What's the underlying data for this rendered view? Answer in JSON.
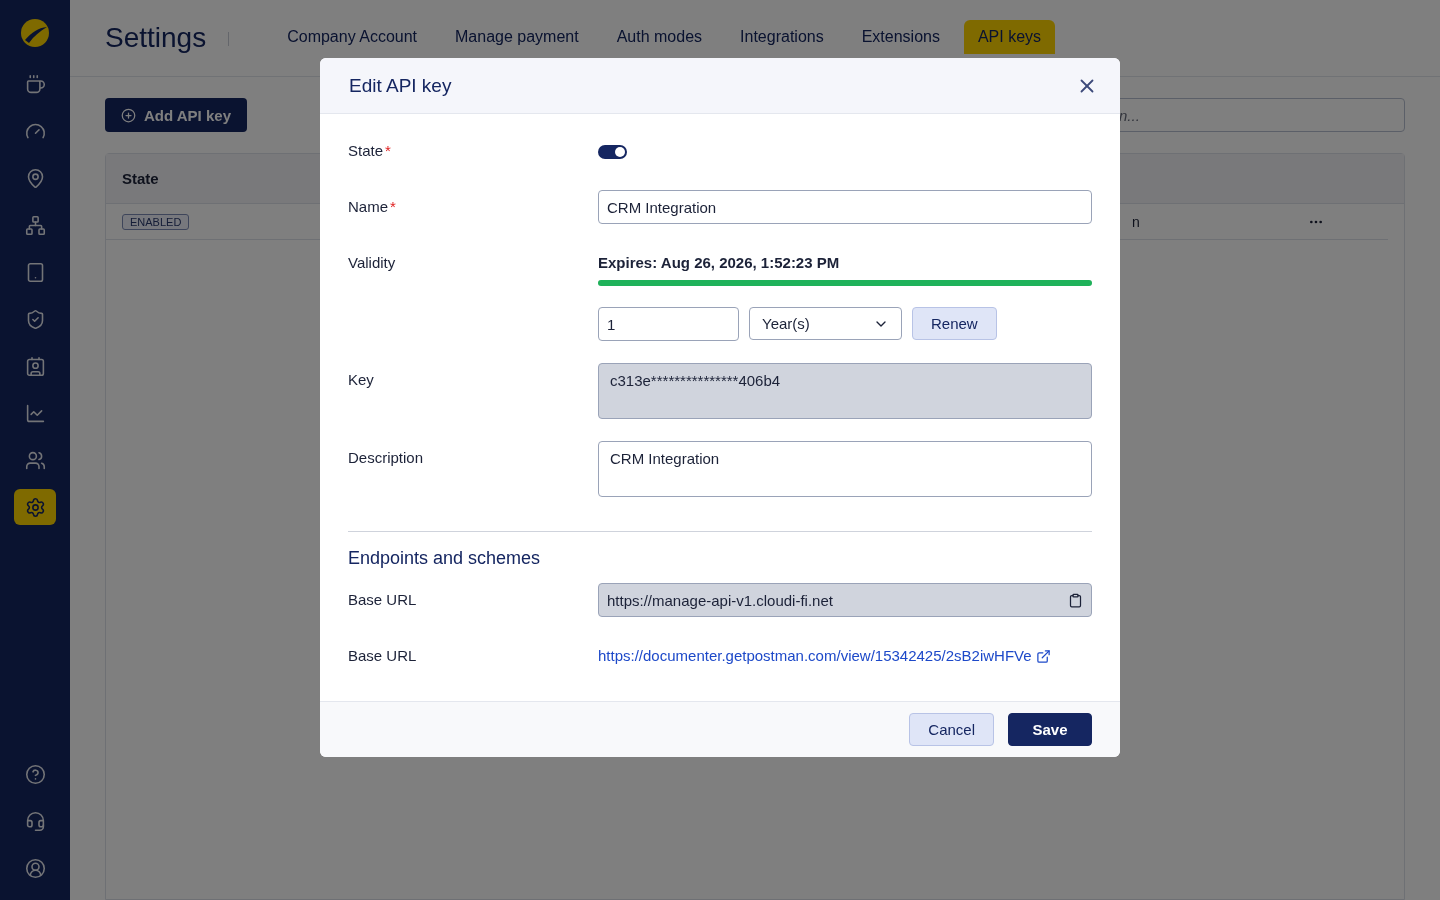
{
  "sidebar": {
    "items": [
      {
        "selected": false
      },
      {
        "selected": false
      },
      {
        "selected": false
      },
      {
        "selected": false
      },
      {
        "selected": false
      },
      {
        "selected": false
      },
      {
        "selected": false
      },
      {
        "selected": false
      },
      {
        "selected": false
      },
      {
        "selected": true
      }
    ],
    "footer_items": [
      {
        "selected": false
      },
      {
        "selected": false
      },
      {
        "selected": false
      }
    ]
  },
  "header": {
    "title": "Settings",
    "tabs": [
      {
        "label": "Company Account",
        "selected": false
      },
      {
        "label": "Manage payment",
        "selected": false
      },
      {
        "label": "Auth modes",
        "selected": false
      },
      {
        "label": "Integrations",
        "selected": false
      },
      {
        "label": "Extensions",
        "selected": false
      },
      {
        "label": "API keys",
        "selected": true
      }
    ]
  },
  "toolbar": {
    "add_button": "Add API key",
    "search": {
      "placeholder": "n..."
    }
  },
  "table": {
    "columns": [
      "State"
    ],
    "rows": [
      {
        "state": "ENABLED",
        "column_3": "n"
      }
    ]
  },
  "dialog": {
    "title": "Edit API key",
    "required_mark": "*",
    "fields": [
      {
        "kind": "toggle",
        "label": "State",
        "required": true,
        "on": true
      },
      {
        "kind": "text",
        "label": "Name",
        "required": true,
        "value": "CRM Integration"
      },
      {
        "kind": "validity",
        "label": "Validity",
        "required": false,
        "expires": "Expires: Aug 26, 2026, 1:52:23 PM",
        "level": 1,
        "amount": "1",
        "unit": "Year(s)",
        "renew": "Renew"
      },
      {
        "kind": "textarea",
        "label": "Key",
        "required": false,
        "value": "c313e***************406b4",
        "disabled": true
      },
      {
        "kind": "textarea",
        "label": "Description",
        "required": false,
        "value": "CRM Integration",
        "disabled": false
      }
    ],
    "section": "Endpoints and schemes",
    "endpoints": [
      {
        "kind": "copy",
        "label": "Base URL",
        "value": "https://manage-api-v1.cloudi-fi.net"
      },
      {
        "kind": "link",
        "label": "Base URL",
        "value": "https://documenter.getpostman.com/view/15342425/2sB2iwHFVe"
      }
    ],
    "buttons": [
      {
        "kind": "secondary",
        "label": "Cancel"
      },
      {
        "kind": "primary",
        "label": "Save"
      }
    ]
  }
}
